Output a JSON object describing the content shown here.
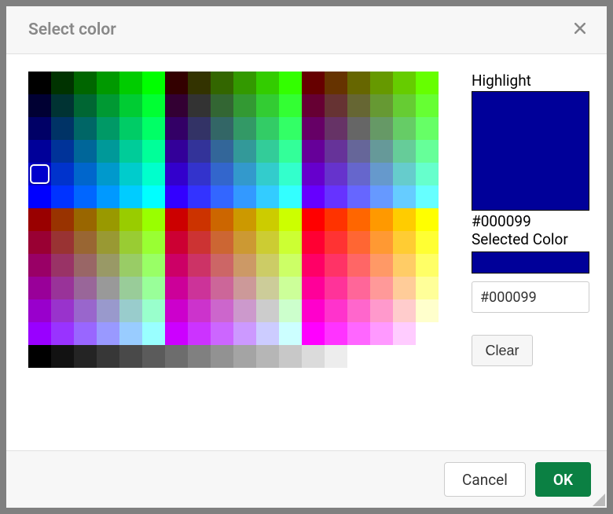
{
  "dialog": {
    "title": "Select color",
    "highlight_label": "Highlight",
    "selected_label": "Selected Color",
    "hex_readout": "#000099",
    "hex_input_value": "#000099",
    "clear_label": "Clear",
    "cancel_label": "Cancel",
    "ok_label": "OK",
    "highlight_color": "#000099",
    "selected_color": "#000099"
  },
  "palette": {
    "selected_index": 72,
    "hues_block1": [
      "#000000",
      "#003300",
      "#006600",
      "#009900",
      "#00cc00",
      "#00ff00"
    ],
    "hues_block2": [
      "#330000",
      "#333300",
      "#336600",
      "#339900",
      "#33cc00",
      "#33ff00"
    ],
    "hues_block3": [
      "#660000",
      "#663300",
      "#666600",
      "#669900",
      "#66cc00",
      "#66ff00"
    ],
    "rows_top": [
      [
        "#000000",
        "#000033",
        "#000066",
        "#000099",
        "#0000cc",
        "#0000ff"
      ],
      [
        "#003300",
        "#003333",
        "#003366",
        "#003399",
        "#0033cc",
        "#0033ff"
      ],
      [
        "#006600",
        "#006633",
        "#006666",
        "#006699",
        "#0066cc",
        "#0066ff"
      ],
      [
        "#009900",
        "#009933",
        "#009966",
        "#009999",
        "#0099cc",
        "#0099ff"
      ],
      [
        "#00cc00",
        "#00cc33",
        "#00cc66",
        "#00cc99",
        "#00cccc",
        "#00ccff"
      ],
      [
        "#00ff00",
        "#00ff33",
        "#00ff66",
        "#00ff99",
        "#00ffcc",
        "#00ffff"
      ]
    ]
  }
}
